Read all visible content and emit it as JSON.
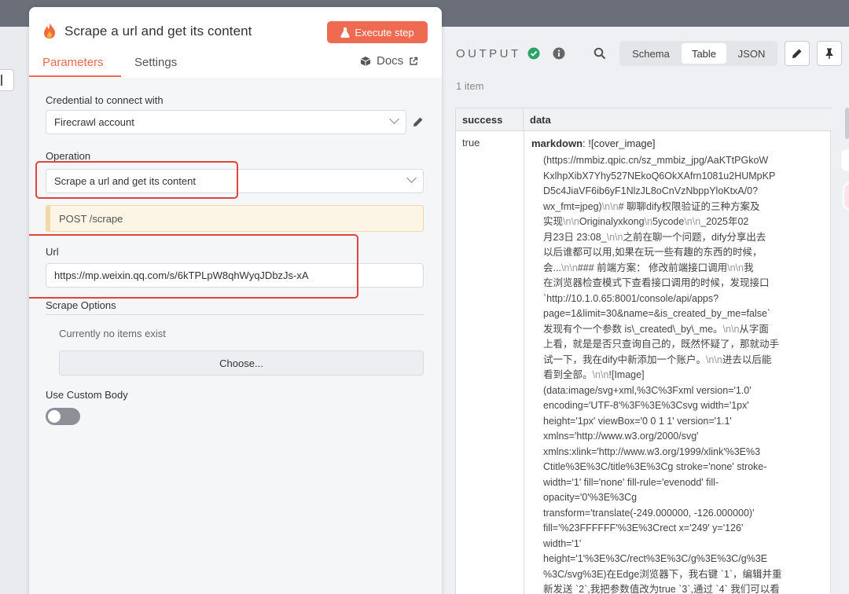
{
  "panel": {
    "title": "Scrape a url and get its content",
    "execute_label": "Execute step",
    "tabs": {
      "parameters": "Parameters",
      "settings": "Settings",
      "docs": "Docs"
    },
    "credential": {
      "label": "Credential to connect with",
      "value": "Firecrawl account"
    },
    "operation": {
      "label": "Operation",
      "value": "Scrape a url and get its content"
    },
    "endpoint": "POST /scrape",
    "url": {
      "label": "Url",
      "value": "https://mp.weixin.qq.com/s/6kTPLpW8qhWyqJDbzJs-xA"
    },
    "scrape_options": {
      "label": "Scrape Options",
      "empty": "Currently no items exist",
      "choose": "Choose..."
    },
    "custom_body": {
      "label": "Use Custom Body",
      "enabled": false
    }
  },
  "output": {
    "label": "OUTPUT",
    "view_modes": {
      "schema": "Schema",
      "table": "Table",
      "json": "JSON",
      "selected": "Table"
    },
    "item_count": "1 item",
    "columns": [
      "success",
      "data"
    ],
    "row": {
      "success": "true",
      "data_key": "markdown",
      "data_lines": [
        ": ![cover_image]",
        "(https://mmbiz.qpic.cn/sz_mmbiz_jpg/AaKTtPGkoW",
        "KxlhpXibX7Yhy527NEkoQ6OkXAfrn1081u2HUMpKP",
        "D5c4JiaVF6ib6yF1NlzJL8oCnVzNbppYloKtxA/0?",
        "wx_fmt=jpeg)\\n\\n# 聊聊dify权限验证的三种方案及",
        "实现\\n\\nOriginalyxkong\\n5ycode\\n\\n_2025年02",
        "月23日 23:08_\\n\\n之前在聊一个问题，dify分享出去",
        "以后谁都可以用,如果在玩一些有趣的东西的时候，",
        "会...\\n\\n### 前端方案： 修改前端接口调用\\n\\n我",
        "在浏览器检查模式下查看接口调用的时候，发现接口",
        "`http://10.1.0.65:8001/console/api/apps?",
        "page=1&limit=30&name=&is_created_by_me=false`",
        "发现有个一个参数 is\\_created\\_by\\_me。\\n\\n从字面",
        "上看，就是是否只查询自己的，既然怀疑了，那就动手",
        "试一下，我在dify中新添加一个账户。\\n\\n进去以后能",
        "看到全部。\\n\\n![Image]",
        "(data:image/svg+xml,%3C%3Fxml version='1.0'",
        "encoding='UTF-8'%3F%3E%3Csvg width='1px'",
        "height='1px' viewBox='0 0 1 1' version='1.1'",
        "xmlns='http://www.w3.org/2000/svg'",
        "xmlns:xlink='http://www.w3.org/1999/xlink'%3E%3",
        "Ctitle%3E%3C/title%3E%3Cg stroke='none' stroke-",
        "width='1' fill='none' fill-rule='evenodd' fill-",
        "opacity='0'%3E%3Cg",
        "transform='translate(-249.000000, -126.000000)'",
        "fill='%23FFFFFF'%3E%3Crect x='249' y='126'",
        "width='1'",
        "height='1'%3E%3C/rect%3E%3C/g%3E%3C/g%3E",
        "%3C/svg%3E)在Edge浏览器下，我右键 `1`，编辑并重",
        "新发送 `2`,我把参数值改为true `3`,通过 `4` 我们可以看"
      ]
    }
  },
  "colors": {
    "accent": "#ee6b51",
    "success": "#29a36a",
    "highlight_border": "#e0443a"
  },
  "icons": [
    "flame-icon",
    "beaker-icon",
    "cube-icon",
    "external-link-icon",
    "pencil-icon",
    "check-circle-icon",
    "info-icon",
    "search-icon",
    "edit-icon",
    "pin-icon",
    "chevron-down-icon"
  ]
}
